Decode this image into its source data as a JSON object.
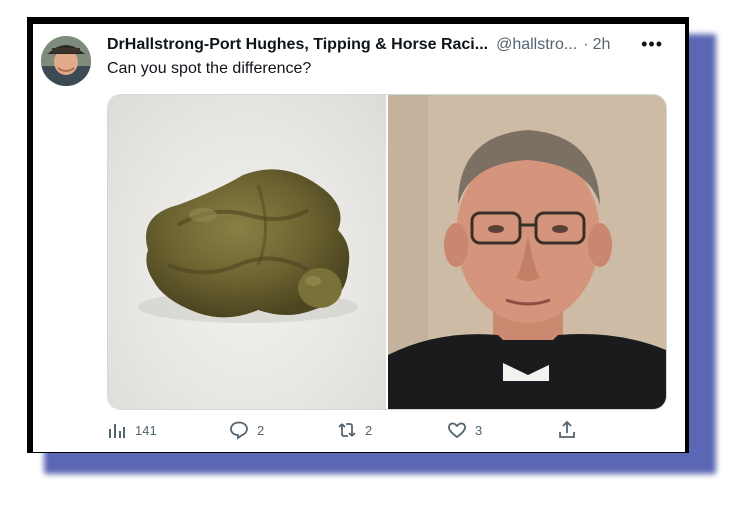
{
  "tweet": {
    "display_name": "DrHallstrong-Port Hughes, Tipping & Horse Raci...",
    "handle": "@hallstro...",
    "separator": "·",
    "time": "2h",
    "more": "•••",
    "text": "Can you spot the difference?"
  },
  "actions": {
    "views": "141",
    "replies": "2",
    "retweets": "2",
    "likes": "3"
  },
  "icons": {
    "views": "bar-chart-icon",
    "reply": "comment-icon",
    "retweet": "retweet-icon",
    "like": "heart-icon",
    "share": "share-icon",
    "more": "more-icon"
  },
  "colors": {
    "frame": "#000000",
    "shadow": "#5a67b4",
    "text": "#0f1419",
    "muted": "#536471"
  }
}
